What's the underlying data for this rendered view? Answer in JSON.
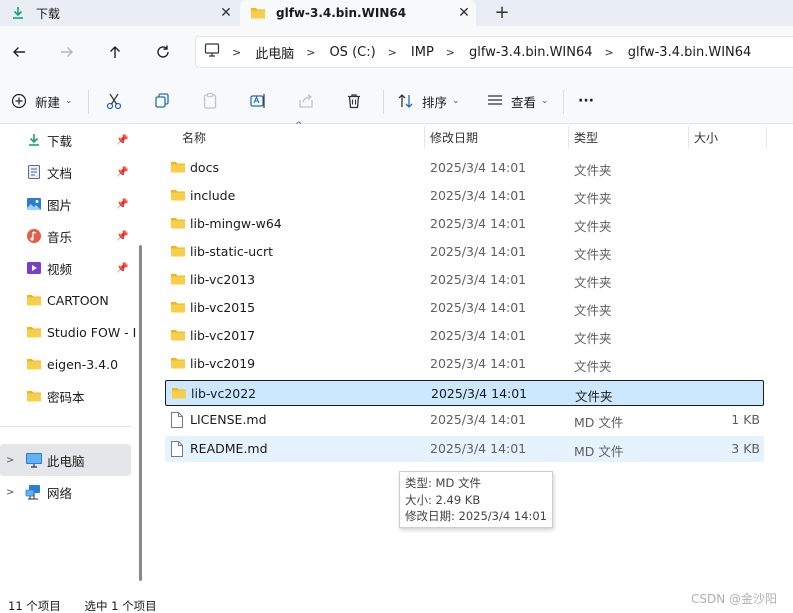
{
  "tabs": [
    {
      "label": "下载",
      "icon": "download-icon",
      "close": "✕"
    },
    {
      "label": "glfw-3.4.bin.WIN64",
      "icon": "folder-icon",
      "close": "✕"
    }
  ],
  "new_tab": "+",
  "address": {
    "crumbs": [
      "此电脑",
      "OS (C:)",
      "IMP",
      "glfw-3.4.bin.WIN64",
      "glfw-3.4.bin.WIN64"
    ]
  },
  "toolbar": {
    "new_label": "新建",
    "sort_label": "排序",
    "view_label": "查看",
    "more_label": "···"
  },
  "sidebar": {
    "quick": [
      {
        "label": "下载",
        "icon": "download-icon",
        "pinned": true
      },
      {
        "label": "文档",
        "icon": "document-icon",
        "pinned": true
      },
      {
        "label": "图片",
        "icon": "picture-icon",
        "pinned": true
      },
      {
        "label": "音乐",
        "icon": "music-icon",
        "pinned": true
      },
      {
        "label": "视频",
        "icon": "video-icon",
        "pinned": true
      },
      {
        "label": "CARTOON",
        "icon": "folder-icon",
        "pinned": false
      },
      {
        "label": "Studio FOW - I",
        "icon": "folder-icon",
        "pinned": false
      },
      {
        "label": "eigen-3.4.0",
        "icon": "folder-icon",
        "pinned": false
      },
      {
        "label": "密码本",
        "icon": "folder-icon",
        "pinned": false
      }
    ],
    "this_pc": "此电脑",
    "network": "网络"
  },
  "columns": {
    "name": "名称",
    "date": "修改日期",
    "type": "类型",
    "size": "大小"
  },
  "files": [
    {
      "name": "docs",
      "date": "2025/3/4 14:01",
      "type": "文件夹",
      "size": "",
      "icon": "folder"
    },
    {
      "name": "include",
      "date": "2025/3/4 14:01",
      "type": "文件夹",
      "size": "",
      "icon": "folder"
    },
    {
      "name": "lib-mingw-w64",
      "date": "2025/3/4 14:01",
      "type": "文件夹",
      "size": "",
      "icon": "folder"
    },
    {
      "name": "lib-static-ucrt",
      "date": "2025/3/4 14:01",
      "type": "文件夹",
      "size": "",
      "icon": "folder"
    },
    {
      "name": "lib-vc2013",
      "date": "2025/3/4 14:01",
      "type": "文件夹",
      "size": "",
      "icon": "folder"
    },
    {
      "name": "lib-vc2015",
      "date": "2025/3/4 14:01",
      "type": "文件夹",
      "size": "",
      "icon": "folder"
    },
    {
      "name": "lib-vc2017",
      "date": "2025/3/4 14:01",
      "type": "文件夹",
      "size": "",
      "icon": "folder"
    },
    {
      "name": "lib-vc2019",
      "date": "2025/3/4 14:01",
      "type": "文件夹",
      "size": "",
      "icon": "folder"
    },
    {
      "name": "lib-vc2022",
      "date": "2025/3/4 14:01",
      "type": "文件夹",
      "size": "",
      "icon": "folder",
      "state": "selected"
    },
    {
      "name": "LICENSE.md",
      "date": "2025/3/4 14:01",
      "type": "MD 文件",
      "size": "1 KB",
      "icon": "file"
    },
    {
      "name": "README.md",
      "date": "2025/3/4 14:01",
      "type": "MD 文件",
      "size": "3 KB",
      "icon": "file",
      "state": "hover"
    }
  ],
  "tooltip": {
    "type": "类型: MD 文件",
    "size": "大小: 2.49 KB",
    "modified": "修改日期: 2025/3/4 14:01"
  },
  "status": {
    "count": "11 个项目",
    "selected": "选中 1 个项目"
  },
  "watermark": "CSDN @金沙阳",
  "colors": {
    "accent": "#1d9bf0",
    "folder": "#f7c948",
    "selection": "#cce8ff",
    "hover": "#e5f3ff"
  }
}
